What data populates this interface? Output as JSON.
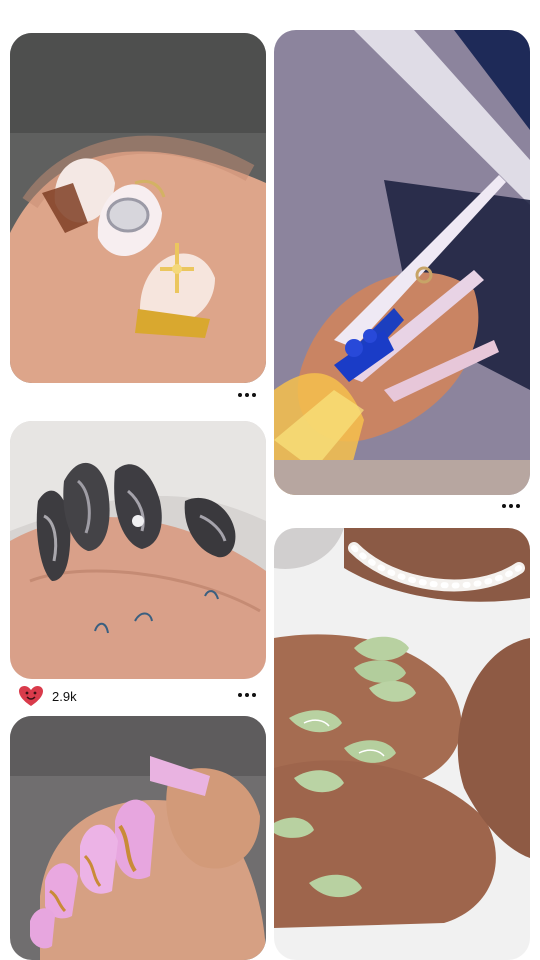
{
  "feed": {
    "pins": [
      {
        "name": "pin-nails-gold-cross",
        "colors": {
          "bg": "#5d5e5d",
          "skin": "#dca489",
          "nail": "#f3e3d8",
          "accent": "#d9a82f"
        }
      },
      {
        "name": "pin-nails-blue-stiletto",
        "colors": {
          "bg": "#9a93ab",
          "skin": "#c7805f",
          "nail": "#ecd7e3",
          "accent": "#1c3fbf"
        }
      },
      {
        "name": "pin-nails-chrome-black",
        "colors": {
          "bg": "#d6d3d1",
          "skin": "#d79f86",
          "nail": "#3b3a3d",
          "accent": "#8d8b91"
        }
      },
      {
        "name": "pin-nails-sage-green",
        "colors": {
          "bg": "#f1f1f1",
          "skin": "#a66d52",
          "nail": "#b8d1a1",
          "accent": "#ffffff"
        }
      },
      {
        "name": "pin-nails-pink-gold",
        "colors": {
          "bg": "#6f6c6d",
          "skin": "#d39c7c",
          "nail": "#e7a6df",
          "accent": "#c98b38"
        }
      }
    ],
    "reaction": {
      "icon": "heart-face-icon",
      "count": "2.9k",
      "color": "#d93b4b"
    },
    "more_icon": "more-dots-icon"
  }
}
